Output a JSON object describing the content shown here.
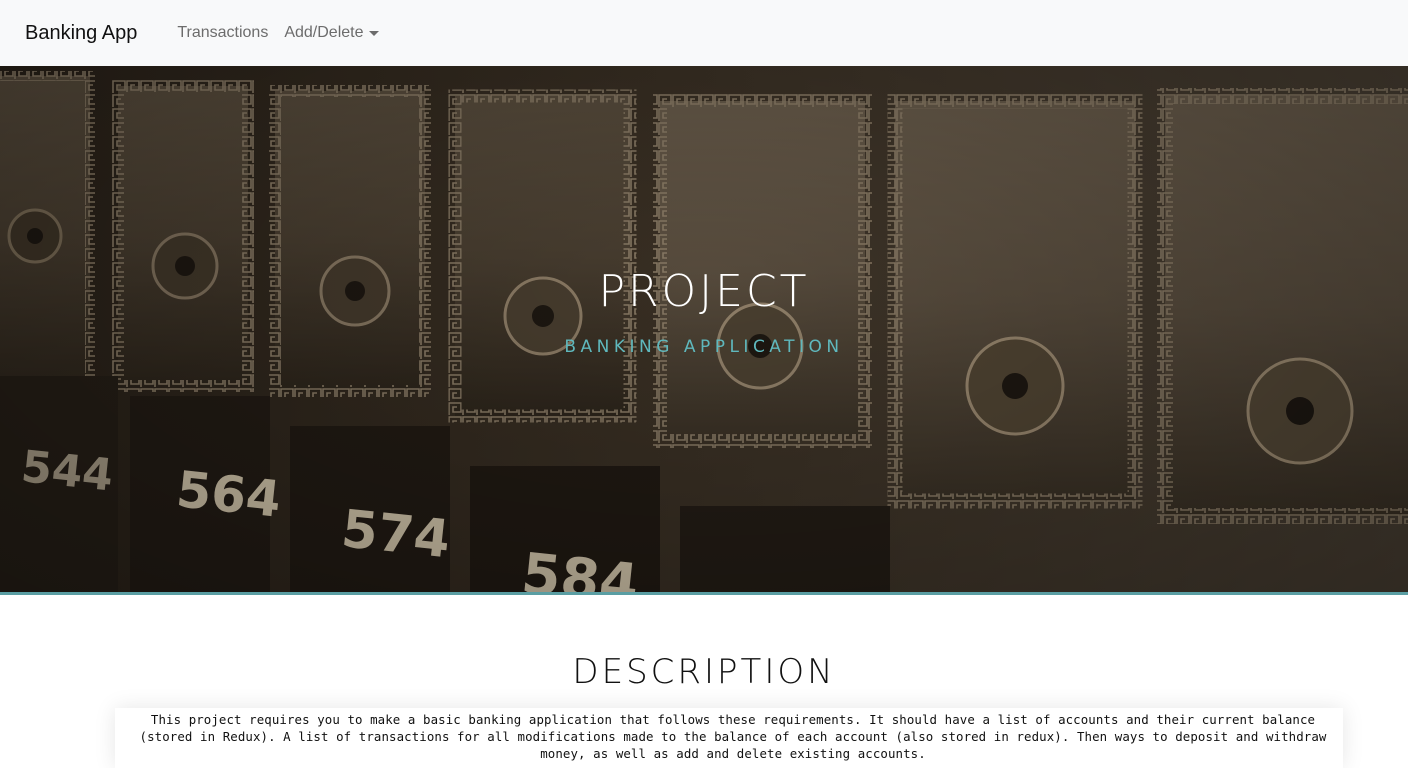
{
  "navbar": {
    "brand": "Banking App",
    "links": [
      {
        "label": "Transactions"
      },
      {
        "label": "Add/Delete",
        "dropdown": true
      }
    ]
  },
  "hero": {
    "title": "PROJECT",
    "subtitle": "BANKING APPLICATION",
    "box_numbers": [
      "544",
      "564",
      "574",
      "584"
    ],
    "accent_color": "#5fb8bd"
  },
  "description": {
    "title": "DESCRIPTION",
    "text": "This project requires you to make a basic banking application that follows these requirements. It should have a list of accounts and their current balance (stored in Redux). A list of transactions for all modifications made to the balance of each account (also stored in redux). Then ways to deposit and withdraw money, as well as add and delete existing accounts."
  }
}
